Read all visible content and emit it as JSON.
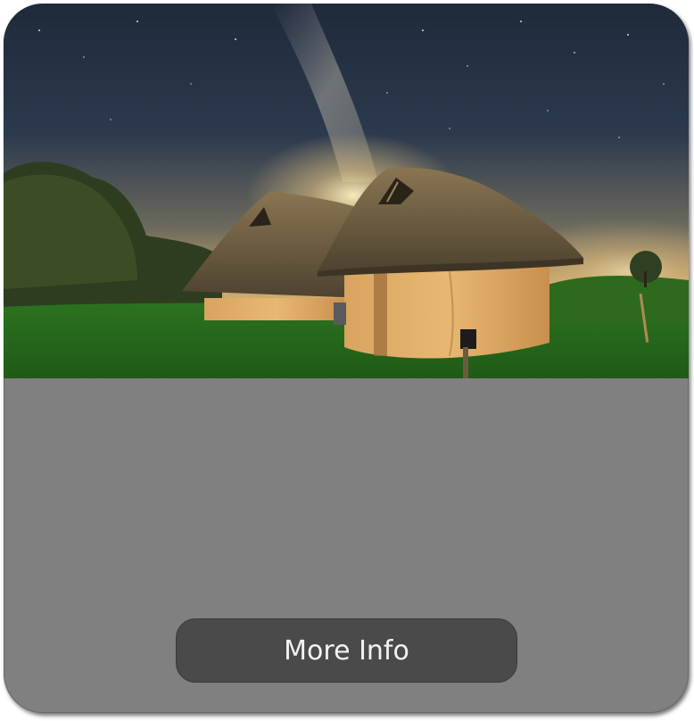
{
  "card": {
    "image_subject": "thatched-roundhouses-under-milky-way",
    "button": {
      "label": "More Info"
    }
  },
  "colors": {
    "card_background": "#808080",
    "button_background": "#4a4a4a",
    "button_text": "#f2f2f2"
  }
}
